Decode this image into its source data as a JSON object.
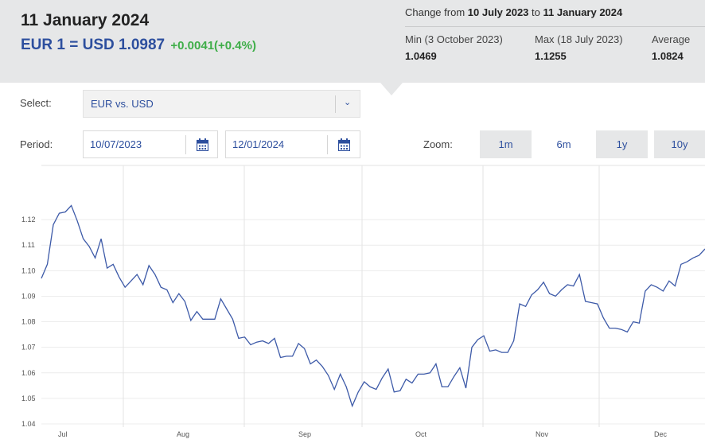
{
  "header": {
    "date": "11 January 2024",
    "rate": "EUR 1 = USD 1.0987",
    "change": "+0.0041(+0.4%)"
  },
  "summary": {
    "change_prefix": "Change from",
    "from_date": "10 July 2023",
    "to_word": "to",
    "to_date": "11 January 2024",
    "min_label": "Min (3 October 2023)",
    "min_value": "1.0469",
    "max_label": "Max (18 July 2023)",
    "max_value": "1.1255",
    "avg_label": "Average",
    "avg_value": "1.0824"
  },
  "controls": {
    "select_label": "Select:",
    "select_value": "EUR vs. USD",
    "period_label": "Period:",
    "period_start": "10/07/2023",
    "period_end": "12/01/2024",
    "zoom_label": "Zoom:",
    "zoom_options": [
      "1m",
      "6m",
      "1y",
      "10y"
    ],
    "zoom_selected": "6m"
  },
  "colors": {
    "accent": "#2d4f9e",
    "positive": "#3fae49",
    "panel": "#e6e7e8",
    "line": "#3d5aa8"
  },
  "chart_data": {
    "type": "line",
    "title": "",
    "xlabel": "",
    "ylabel": "",
    "ylim": [
      1.04,
      1.13
    ],
    "y_ticks": [
      "1.04",
      "1.05",
      "1.06",
      "1.07",
      "1.08",
      "1.09",
      "1.10",
      "1.11",
      "1.12"
    ],
    "x_ticks": [
      "Jul",
      "Aug",
      "Sep",
      "Oct",
      "Nov",
      "Dec"
    ],
    "grid": true,
    "series": [
      {
        "values": [
          1.097,
          1.1025,
          1.118,
          1.1225,
          1.123,
          1.1255,
          1.1195,
          1.1125,
          1.1095,
          1.105,
          1.1125,
          1.101,
          1.1025,
          1.0975,
          1.0935,
          1.096,
          1.0985,
          1.0945,
          1.102,
          1.0985,
          1.0935,
          1.0925,
          1.0875,
          1.091,
          1.088,
          1.0805,
          1.084,
          1.081,
          1.081,
          1.081,
          1.089,
          1.085,
          1.081,
          1.0735,
          1.074,
          1.071,
          1.072,
          1.0725,
          1.0715,
          1.0735,
          1.066,
          1.0665,
          1.0665,
          1.0715,
          1.0695,
          1.0635,
          1.065,
          1.0625,
          1.059,
          1.0535,
          1.0595,
          1.0545,
          1.047,
          1.0525,
          1.0565,
          1.0545,
          1.0535,
          1.058,
          1.0615,
          1.0525,
          1.053,
          1.0575,
          1.056,
          1.0595,
          1.0595,
          1.06,
          1.0635,
          1.0545,
          1.0545,
          1.0585,
          1.062,
          1.054,
          1.07,
          1.073,
          1.0745,
          1.0685,
          1.069,
          1.068,
          1.068,
          1.0725,
          1.087,
          1.086,
          1.0905,
          1.0925,
          1.0955,
          1.091,
          1.09,
          1.0925,
          1.0945,
          1.094,
          1.0985,
          1.088,
          1.0875,
          1.087,
          1.0815,
          1.0775,
          1.0775,
          1.077,
          1.076,
          1.08,
          1.0795,
          1.092,
          1.0945,
          1.0935,
          1.092,
          1.096,
          1.094,
          1.1025,
          1.1035,
          1.105,
          1.106,
          1.1085
        ]
      }
    ]
  }
}
